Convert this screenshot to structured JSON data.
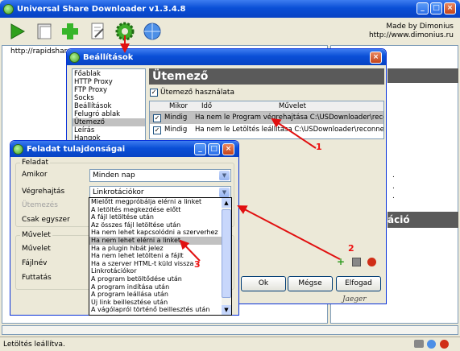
{
  "main_window": {
    "title": "Universal Share Downloader v1.3.4.8",
    "made_by": "Made by Dimonius",
    "site": "http://www.dimonius.ru",
    "url_item": "http://rapidshare.co",
    "status": "Letöltés leállítva.",
    "right_header_fragment": "áció",
    "bg_header_fragment": "ó",
    "icons": [
      "play-icon",
      "window-icon",
      "add-icon",
      "script-icon",
      "settings-gear-icon",
      "globe-icon"
    ]
  },
  "settings": {
    "title": "Beállítások",
    "nav": [
      "Főablak",
      "HTTP Proxy",
      "FTP Proxy",
      "Socks",
      "Beállítások",
      "Felugró ablak",
      "Ütemező",
      "Leírás",
      "Hangok"
    ],
    "selected_nav": "Ütemező",
    "heading": "Ütemező",
    "use_scheduler_label": "Ütemező használata",
    "columns": [
      "Mikor",
      "Idő",
      "Művelet"
    ],
    "rows": [
      {
        "checked": true,
        "when": "Mindig",
        "time": "",
        "action": "Ha nem le Program végrehajtása C:\\USDownloader\\reconne"
      },
      {
        "checked": true,
        "when": "Mindig",
        "time": "",
        "action": "Ha nem le Letöltés leállítása C:\\USDownloader\\reconnect2.b"
      }
    ],
    "ok_label": "Ok",
    "cancel_label": "Mégse",
    "apply_label": "Elfogad",
    "signature": "Jaeger"
  },
  "task": {
    "title": "Feladat tulajdonságai",
    "group_task": "Feladat",
    "when_label": "Amikor",
    "when_value": "Minden nap",
    "exec_label": "Végrehajtás",
    "exec_value": "Linkrotációkor",
    "schedule_label": "Ütemezés",
    "once_label": "Csak egyszer",
    "group_action": "Művelet",
    "action_label": "Művelet",
    "file_label": "Fájlnév",
    "run_label": "Futtatás"
  },
  "dropdown": {
    "items": [
      "Mielőtt megpróbálja elérni a linket",
      "A letöltés megkezdése előtt",
      "A fájl letöltése után",
      "Az összes fájl letöltése után",
      "Ha nem lehet kapcsolódni a szerverhez",
      "Ha nem lehet elérni a linket",
      "Ha a plugin hibát jelez",
      "Ha nem lehet letölteni a fájlt",
      "Ha a szerver HTML-t küld vissza",
      "Linkrotációkor",
      "A program betöltődése után",
      "A program indítása után",
      "A program leállása után",
      "Új link beillesztése után",
      "A vágólapról történő beillesztés után"
    ],
    "highlighted": "Ha nem lehet elérni a linket"
  },
  "annotations": [
    "1",
    "2",
    "3"
  ],
  "colors": {
    "title_blue": "#0a4fd6",
    "arrow_red": "#e11010",
    "accent_green": "#3e9b1f"
  }
}
